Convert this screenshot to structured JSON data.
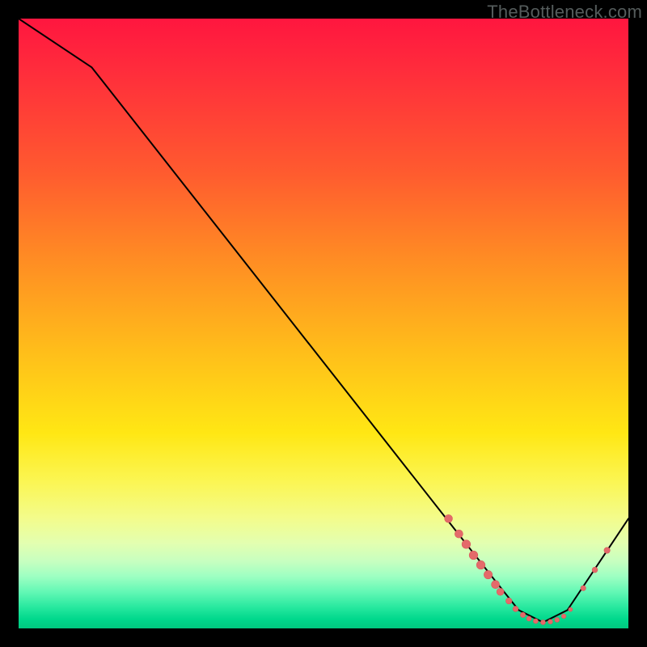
{
  "watermark": {
    "text": "TheBottleneck.com"
  },
  "colors": {
    "line": "#000000",
    "marker_fill": "#e46a6a",
    "marker_stroke": "#d85a5a"
  },
  "chart_data": {
    "type": "line",
    "title": "",
    "xlabel": "",
    "ylabel": "",
    "xlim": [
      0,
      100
    ],
    "ylim": [
      0,
      100
    ],
    "grid": false,
    "legend": false,
    "annotations": [
      "TheBottleneck.com"
    ],
    "series": [
      {
        "name": "curve",
        "x": [
          0,
          12,
          78,
          82,
          86,
          90,
          100
        ],
        "y": [
          100,
          92,
          8,
          3,
          1,
          3,
          18
        ]
      }
    ],
    "markers": [
      {
        "x": 70.5,
        "y": 18.0,
        "r": 4.9
      },
      {
        "x": 72.2,
        "y": 15.5,
        "r": 5.0
      },
      {
        "x": 73.4,
        "y": 13.8,
        "r": 5.3
      },
      {
        "x": 74.6,
        "y": 12.0,
        "r": 5.3
      },
      {
        "x": 75.8,
        "y": 10.4,
        "r": 5.3
      },
      {
        "x": 77.0,
        "y": 8.8,
        "r": 5.2
      },
      {
        "x": 78.2,
        "y": 7.2,
        "r": 5.0
      },
      {
        "x": 79.0,
        "y": 6.0,
        "r": 4.5
      },
      {
        "x": 80.4,
        "y": 4.5,
        "r": 3.8
      },
      {
        "x": 81.5,
        "y": 3.2,
        "r": 3.4
      },
      {
        "x": 82.7,
        "y": 2.2,
        "r": 3.2
      },
      {
        "x": 83.7,
        "y": 1.6,
        "r": 3.0
      },
      {
        "x": 84.8,
        "y": 1.2,
        "r": 3.0
      },
      {
        "x": 86.0,
        "y": 1.0,
        "r": 3.0
      },
      {
        "x": 87.2,
        "y": 1.1,
        "r": 2.9
      },
      {
        "x": 88.3,
        "y": 1.4,
        "r": 2.9
      },
      {
        "x": 89.4,
        "y": 2.0,
        "r": 2.8
      },
      {
        "x": 90.5,
        "y": 3.1,
        "r": 2.5
      },
      {
        "x": 92.6,
        "y": 6.6,
        "r": 3.2
      },
      {
        "x": 94.5,
        "y": 9.6,
        "r": 3.4
      },
      {
        "x": 96.5,
        "y": 12.8,
        "r": 3.7
      }
    ]
  }
}
